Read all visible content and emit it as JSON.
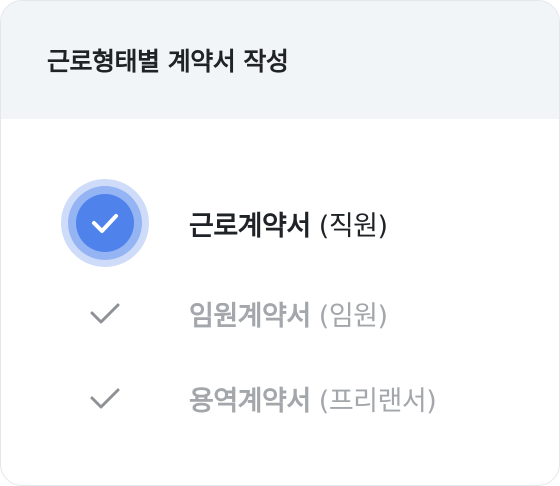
{
  "card": {
    "title": "근로형태별 계약서 작성"
  },
  "options": [
    {
      "main": "근로계약서",
      "sub": "(직원)",
      "selected": true,
      "icon": "check-circle-icon"
    },
    {
      "main": "임원계약서",
      "sub": "(임원)",
      "selected": false,
      "icon": "check-icon"
    },
    {
      "main": "용역계약서",
      "sub": "(프리랜서)",
      "selected": false,
      "icon": "check-icon"
    }
  ],
  "colors": {
    "accent": "#4f83eb",
    "header_bg": "#f2f5f8",
    "text_active": "#1f2226",
    "text_inactive": "#a3a6aa",
    "check_inactive": "#8e9196"
  }
}
